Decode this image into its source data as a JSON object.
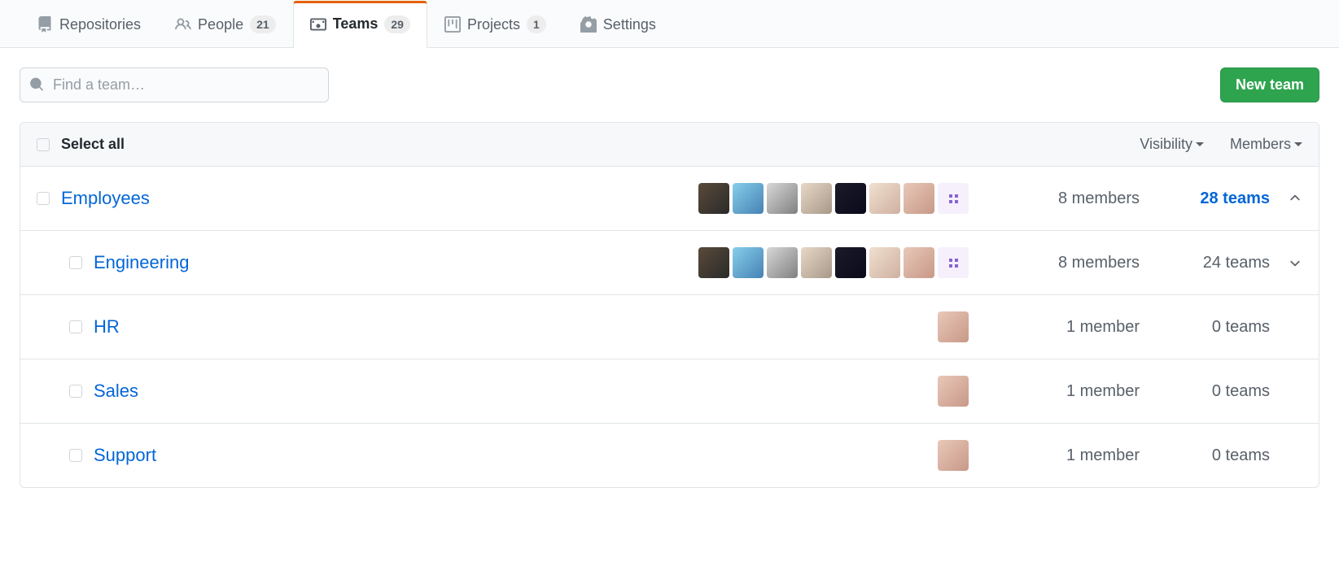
{
  "tabs": [
    {
      "label": "Repositories",
      "icon": "repo",
      "badge": null,
      "active": false
    },
    {
      "label": "People",
      "icon": "people",
      "badge": "21",
      "active": false
    },
    {
      "label": "Teams",
      "icon": "teams",
      "badge": "29",
      "active": true
    },
    {
      "label": "Projects",
      "icon": "project",
      "badge": "1",
      "active": false
    },
    {
      "label": "Settings",
      "icon": "gear",
      "badge": null,
      "active": false
    }
  ],
  "search": {
    "placeholder": "Find a team…"
  },
  "buttons": {
    "new_team": "New team"
  },
  "list": {
    "select_all_label": "Select all",
    "filter_visibility": "Visibility",
    "filter_members": "Members"
  },
  "teams": [
    {
      "name": "Employees",
      "members": "8 members",
      "subteams": "28 teams",
      "avatars": 8,
      "nested": false,
      "highlight_teams": true,
      "expand": "up"
    },
    {
      "name": "Engineering",
      "members": "8 members",
      "subteams": "24 teams",
      "avatars": 8,
      "nested": true,
      "highlight_teams": false,
      "expand": "down"
    },
    {
      "name": "HR",
      "members": "1 member",
      "subteams": "0 teams",
      "avatars": 1,
      "nested": true,
      "highlight_teams": false,
      "expand": null
    },
    {
      "name": "Sales",
      "members": "1 member",
      "subteams": "0 teams",
      "avatars": 1,
      "nested": true,
      "highlight_teams": false,
      "expand": null
    },
    {
      "name": "Support",
      "members": "1 member",
      "subteams": "0 teams",
      "avatars": 1,
      "nested": true,
      "highlight_teams": false,
      "expand": null
    }
  ]
}
